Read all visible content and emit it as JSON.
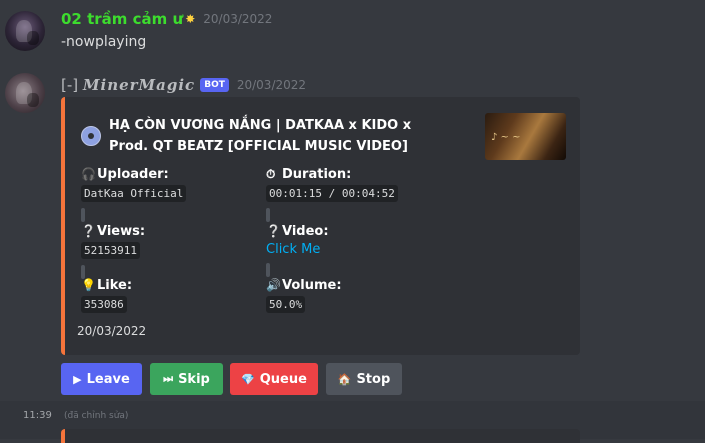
{
  "message1": {
    "username": "02 trầm cảm ư",
    "badge_icon": "sparkle-icon",
    "timestamp": "20/03/2022",
    "content": "-nowplaying"
  },
  "message2": {
    "username_prefix": "[-] ",
    "username": "MinerMagic",
    "bot_tag": "BOT",
    "timestamp": "20/03/2022",
    "edited_time": "11:39",
    "edited_label": "(đã chỉnh sửa)"
  },
  "embed": {
    "accent_color": "#f5743b",
    "icon": "disc-icon",
    "title": "HẠ CÒN VƯƠNG NẮNG | DATKAA x KIDO x Prod. QT BEATZ [OFFICIAL MUSIC VIDEO]",
    "thumbnail_icon": "video-thumbnail",
    "fields": {
      "uploader": {
        "name": "Uploader:",
        "value": "DatKaa Official",
        "icon": "headphones-icon"
      },
      "duration": {
        "name": "Duration:",
        "value": "00:01:15 / 00:04:52",
        "icon": "stopwatch-icon"
      },
      "views": {
        "name": "Views:",
        "value": "52153911",
        "icon": "question-icon"
      },
      "video": {
        "name": "Video:",
        "value": "Click Me",
        "icon": "question-icon"
      },
      "like": {
        "name": "Like:",
        "value": "353086",
        "icon": "lightbulb-icon"
      },
      "volume": {
        "name": "Volume:",
        "value": "50.0%",
        "icon": "speaker-icon"
      }
    },
    "footer": "20/03/2022"
  },
  "buttons": {
    "leave": {
      "label": "Leave",
      "icon": "play-icon",
      "color": "#5865f2"
    },
    "skip": {
      "label": "Skip",
      "icon": "skip-icon",
      "color": "#3ba55d"
    },
    "queue": {
      "label": "Queue",
      "icon": "gem-icon",
      "color": "#ed4245"
    },
    "stop": {
      "label": "Stop",
      "icon": "home-icon",
      "color": "#4f545c"
    }
  }
}
